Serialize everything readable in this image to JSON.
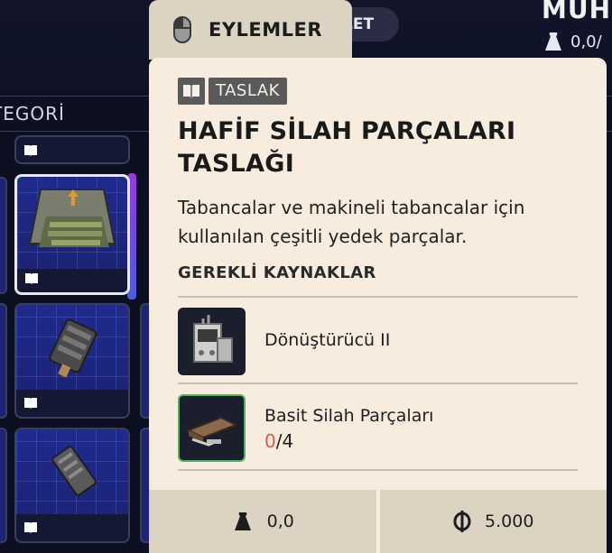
{
  "background": {
    "top_pill_label": "LET",
    "top_title": "MUH",
    "top_weight": "0,0/",
    "category_label": "TEGORİ"
  },
  "actions_tab": {
    "label": "EYLEMLER",
    "icon": "mouse-icon"
  },
  "item": {
    "badge_icon": "book-icon",
    "badge_label": "TASLAK",
    "title": "HAFİF SİLAH PARÇALARI TASLAĞI",
    "description": "Tabancalar ve makineli tabancalar için kullanılan çeşitli yedek parçalar.",
    "required_heading": "GEREKLİ KAYNAKLAR",
    "resources": [
      {
        "name": "Dönüştürücü II",
        "icon": "converter-machine-icon"
      },
      {
        "name": "Basit Silah Parçaları",
        "icon": "weapon-parts-icon",
        "have": "0",
        "need": "/4"
      }
    ],
    "weight": "0,0",
    "price": "5.000"
  },
  "colors": {
    "panel_bg": "#f7ecdd",
    "tab_bg": "#ddd3c3",
    "shortage_red": "#e05a4a",
    "slot_blue": "#1f2a8c",
    "highlight_green": "#4fb06a"
  }
}
